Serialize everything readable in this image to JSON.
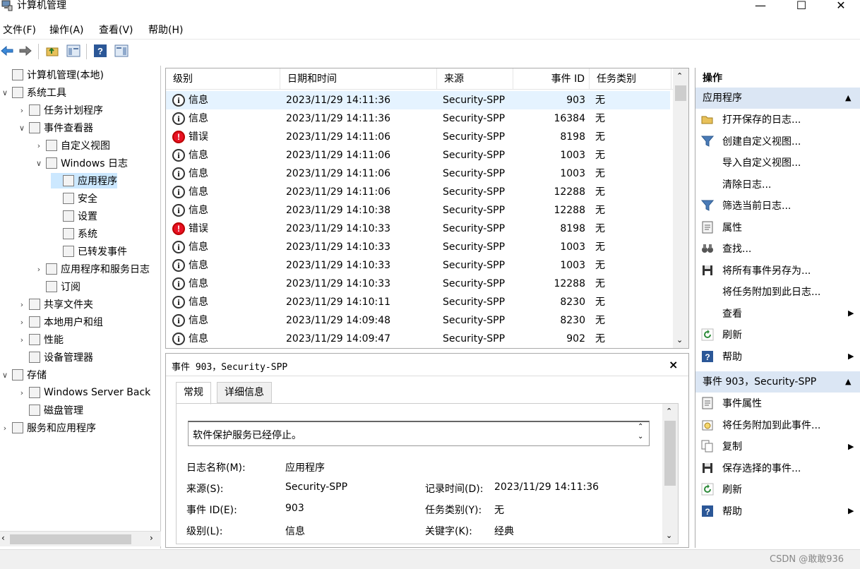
{
  "window": {
    "title": "计算机管理",
    "minimize": "—",
    "maximize": "☐",
    "close": "✕"
  },
  "menu": [
    "文件(F)",
    "操作(A)",
    "查看(V)",
    "帮助(H)"
  ],
  "tree": [
    {
      "label": "计算机管理(本地)",
      "chev": "",
      "level": 0
    },
    {
      "label": "系统工具",
      "chev": "∨",
      "level": 0
    },
    {
      "label": "任务计划程序",
      "chev": "›",
      "level": 1
    },
    {
      "label": "事件查看器",
      "chev": "∨",
      "level": 1
    },
    {
      "label": "自定义视图",
      "chev": "›",
      "level": 2
    },
    {
      "label": "Windows 日志",
      "chev": "∨",
      "level": 2
    },
    {
      "label": "应用程序",
      "chev": "",
      "level": 3,
      "selected": true
    },
    {
      "label": "安全",
      "chev": "",
      "level": 3
    },
    {
      "label": "设置",
      "chev": "",
      "level": 3
    },
    {
      "label": "系统",
      "chev": "",
      "level": 3
    },
    {
      "label": "已转发事件",
      "chev": "",
      "level": 3
    },
    {
      "label": "应用程序和服务日志",
      "chev": "›",
      "level": 2
    },
    {
      "label": "订阅",
      "chev": "",
      "level": 2
    },
    {
      "label": "共享文件夹",
      "chev": "›",
      "level": 1
    },
    {
      "label": "本地用户和组",
      "chev": "›",
      "level": 1
    },
    {
      "label": "性能",
      "chev": "›",
      "level": 1
    },
    {
      "label": "设备管理器",
      "chev": "",
      "level": 1
    },
    {
      "label": "存储",
      "chev": "∨",
      "level": 0
    },
    {
      "label": "Windows Server Back",
      "chev": "›",
      "level": 1
    },
    {
      "label": "磁盘管理",
      "chev": "",
      "level": 1
    },
    {
      "label": "服务和应用程序",
      "chev": "›",
      "level": 0
    }
  ],
  "list": {
    "headers": [
      "级别",
      "日期和时间",
      "来源",
      "事件 ID",
      "任务类别"
    ],
    "rows": [
      {
        "level": "信息",
        "type": "info",
        "date": "2023/11/29 14:11:36",
        "source": "Security-SPP",
        "id": "903",
        "task": "无"
      },
      {
        "level": "信息",
        "type": "info",
        "date": "2023/11/29 14:11:36",
        "source": "Security-SPP",
        "id": "16384",
        "task": "无"
      },
      {
        "level": "错误",
        "type": "error",
        "date": "2023/11/29 14:11:06",
        "source": "Security-SPP",
        "id": "8198",
        "task": "无"
      },
      {
        "level": "信息",
        "type": "info",
        "date": "2023/11/29 14:11:06",
        "source": "Security-SPP",
        "id": "1003",
        "task": "无"
      },
      {
        "level": "信息",
        "type": "info",
        "date": "2023/11/29 14:11:06",
        "source": "Security-SPP",
        "id": "1003",
        "task": "无"
      },
      {
        "level": "信息",
        "type": "info",
        "date": "2023/11/29 14:11:06",
        "source": "Security-SPP",
        "id": "12288",
        "task": "无"
      },
      {
        "level": "信息",
        "type": "info",
        "date": "2023/11/29 14:10:38",
        "source": "Security-SPP",
        "id": "12288",
        "task": "无"
      },
      {
        "level": "错误",
        "type": "error",
        "date": "2023/11/29 14:10:33",
        "source": "Security-SPP",
        "id": "8198",
        "task": "无"
      },
      {
        "level": "信息",
        "type": "info",
        "date": "2023/11/29 14:10:33",
        "source": "Security-SPP",
        "id": "1003",
        "task": "无"
      },
      {
        "level": "信息",
        "type": "info",
        "date": "2023/11/29 14:10:33",
        "source": "Security-SPP",
        "id": "1003",
        "task": "无"
      },
      {
        "level": "信息",
        "type": "info",
        "date": "2023/11/29 14:10:33",
        "source": "Security-SPP",
        "id": "12288",
        "task": "无"
      },
      {
        "level": "信息",
        "type": "info",
        "date": "2023/11/29 14:10:11",
        "source": "Security-SPP",
        "id": "8230",
        "task": "无"
      },
      {
        "level": "信息",
        "type": "info",
        "date": "2023/11/29 14:09:48",
        "source": "Security-SPP",
        "id": "8230",
        "task": "无"
      },
      {
        "level": "信息",
        "type": "info",
        "date": "2023/11/29 14:09:47",
        "source": "Security-SPP",
        "id": "902",
        "task": "无"
      }
    ]
  },
  "detail": {
    "title": "事件 903，Security-SPP",
    "close": "×",
    "tabs": [
      "常规",
      "详细信息"
    ],
    "description": "软件保护服务已经停止。",
    "fields": {
      "log_name_label": "日志名称(M):",
      "log_name": "应用程序",
      "source_label": "来源(S):",
      "source": "Security-SPP",
      "recorded_label": "记录时间(D):",
      "recorded": "2023/11/29 14:11:36",
      "event_id_label": "事件 ID(E):",
      "event_id": "903",
      "task_label": "任务类别(Y):",
      "task": "无",
      "level_label": "级别(L):",
      "level": "信息",
      "keywords_label": "关键字(K):",
      "keywords": "经典"
    }
  },
  "actions": {
    "title": "操作",
    "group1": "应用程序",
    "group1_items": [
      {
        "label": "打开保存的日志...",
        "icon": "folder-open-icon",
        "arrow": ""
      },
      {
        "label": "创建自定义视图...",
        "icon": "filter-icon",
        "arrow": ""
      },
      {
        "label": "导入自定义视图...",
        "icon": "",
        "arrow": ""
      },
      {
        "label": "清除日志...",
        "icon": "",
        "arrow": ""
      },
      {
        "label": "筛选当前日志...",
        "icon": "filter-icon",
        "arrow": ""
      },
      {
        "label": "属性",
        "icon": "properties-icon",
        "arrow": ""
      },
      {
        "label": "查找...",
        "icon": "binoculars-icon",
        "arrow": ""
      },
      {
        "label": "将所有事件另存为...",
        "icon": "save-icon",
        "arrow": ""
      },
      {
        "label": "将任务附加到此日志...",
        "icon": "",
        "arrow": ""
      },
      {
        "label": "查看",
        "icon": "",
        "arrow": "▶"
      },
      {
        "label": "刷新",
        "icon": "refresh-icon",
        "arrow": ""
      },
      {
        "label": "帮助",
        "icon": "help-icon",
        "arrow": "▶"
      }
    ],
    "group2": "事件 903，Security-SPP",
    "group2_items": [
      {
        "label": "事件属性",
        "icon": "properties-icon",
        "arrow": ""
      },
      {
        "label": "将任务附加到此事件...",
        "icon": "task-icon",
        "arrow": ""
      },
      {
        "label": "复制",
        "icon": "copy-icon",
        "arrow": "▶"
      },
      {
        "label": "保存选择的事件...",
        "icon": "save-icon",
        "arrow": ""
      },
      {
        "label": "刷新",
        "icon": "refresh-icon",
        "arrow": ""
      },
      {
        "label": "帮助",
        "icon": "help-icon",
        "arrow": "▶"
      }
    ]
  },
  "watermark": "CSDN @敢敢936",
  "colors": {
    "selection": "#cce8ff",
    "group_header": "#dbe6f4",
    "error": "#e81123",
    "help": "#2b5797",
    "refresh": "#2e8b3a",
    "filter": "#4a7bb7"
  }
}
